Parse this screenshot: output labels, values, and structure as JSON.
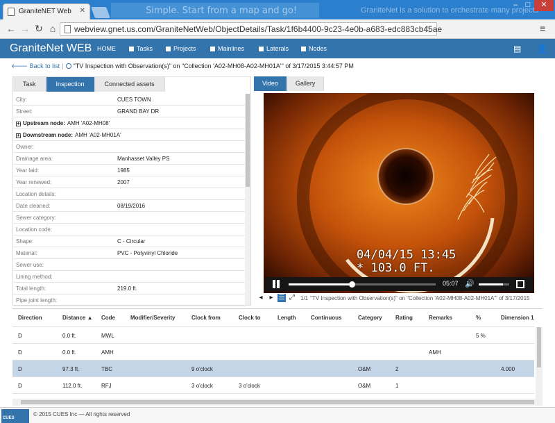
{
  "browser": {
    "tab_title": "GraniteNET Web",
    "banner_text": "Simple. Start from a map and go!",
    "banner_side_text": "GraniteNet is a solution to orchestrate many projects",
    "url": "webview.gnet.us.com/GraniteNetWeb/ObjectDetails/Task/1f6b4400-9c23-4e0b-a683-edc883cb45ae"
  },
  "header": {
    "brand_part1": "Granite",
    "brand_part2": "Net",
    "brand_part3": " WEB",
    "nav": [
      "HOME",
      "Tasks",
      "Projects",
      "Mainlines",
      "Laterals",
      "Nodes"
    ]
  },
  "breadcrumb": {
    "back": "Back to list",
    "title": "\"TV Inspection with Observation(s)\" on \"Collection 'A02-MH08-A02-MH01A'\" of 3/17/2015 3:44:57 PM"
  },
  "left_tabs": [
    "Task",
    "Inspection",
    "Connected assets"
  ],
  "fields": [
    {
      "label": "City:",
      "value": "CUES TOWN"
    },
    {
      "label": "Street:",
      "value": "GRAND BAY DR"
    },
    {
      "label": "Upstream node:",
      "value": "AMH 'A02-MH08'",
      "expandable": true
    },
    {
      "label": "Downstream node:",
      "value": "AMH 'A02-MH01A'",
      "expandable": true
    },
    {
      "label": "Owner:",
      "value": ""
    },
    {
      "label": "Drainage area:",
      "value": "Manhasset Valley PS"
    },
    {
      "label": "Year laid:",
      "value": "1985"
    },
    {
      "label": "Year renewed:",
      "value": "2007"
    },
    {
      "label": "Location details:",
      "value": ""
    },
    {
      "label": "Date cleaned:",
      "value": "08/19/2016"
    },
    {
      "label": "Sewer category:",
      "value": ""
    },
    {
      "label": "Location code:",
      "value": ""
    },
    {
      "label": "Shape:",
      "value": "C - Circular"
    },
    {
      "label": "Material:",
      "value": "PVC - Polyvinyl Chloride"
    },
    {
      "label": "Sewer use:",
      "value": ""
    },
    {
      "label": "Lining method:",
      "value": ""
    },
    {
      "label": "Total length:",
      "value": "219.0 ft."
    },
    {
      "label": "Pipe joint length:",
      "value": ""
    }
  ],
  "right_tabs": [
    "Video",
    "Gallery"
  ],
  "video": {
    "overlay_line1": "04/04/15 13:45",
    "overlay_line2": "* 103.0 FT.",
    "time": "05:07",
    "progress": 0.43,
    "volume": 0.8
  },
  "gallery_strip": {
    "counter": "1/1",
    "caption": "\"TV Inspection with Observation(s)\" on \"Collection 'A02-MH08-A02-MH01A'\" of 3/17/2015"
  },
  "grid": {
    "columns": [
      "Direction",
      "Distance ▲",
      "Code",
      "Modifier/Severity",
      "Clock from",
      "Clock to",
      "Length",
      "Continuous",
      "Category",
      "Rating",
      "Remarks",
      "%",
      "Dimension 1"
    ],
    "rows": [
      {
        "direction": "D",
        "distance": "0.0 ft.",
        "code": "MWL",
        "modifier": "",
        "clock_from": "",
        "clock_to": "",
        "length": "",
        "continuous": "",
        "category": "",
        "rating": "",
        "remarks": "",
        "percent": "5 %",
        "dimension1": ""
      },
      {
        "direction": "D",
        "distance": "0.0 ft.",
        "code": "AMH",
        "modifier": "",
        "clock_from": "",
        "clock_to": "",
        "length": "",
        "continuous": "",
        "category": "",
        "rating": "",
        "remarks": "AMH",
        "percent": "",
        "dimension1": ""
      },
      {
        "direction": "D",
        "distance": "97.3 ft.",
        "code": "TBC",
        "modifier": "",
        "clock_from": "9 o'clock",
        "clock_to": "",
        "length": "",
        "continuous": "",
        "category": "O&M",
        "rating": "2",
        "remarks": "",
        "percent": "",
        "dimension1": "4.000",
        "selected": true
      },
      {
        "direction": "D",
        "distance": "112.0 ft.",
        "code": "RFJ",
        "modifier": "",
        "clock_from": "3 o'clock",
        "clock_to": "3 o'clock",
        "length": "",
        "continuous": "",
        "category": "O&M",
        "rating": "1",
        "remarks": "",
        "percent": "",
        "dimension1": ""
      }
    ]
  },
  "footer": {
    "logo_text": "CUES",
    "copyright": "© 2015 CUES Inc — All rights reserved"
  }
}
